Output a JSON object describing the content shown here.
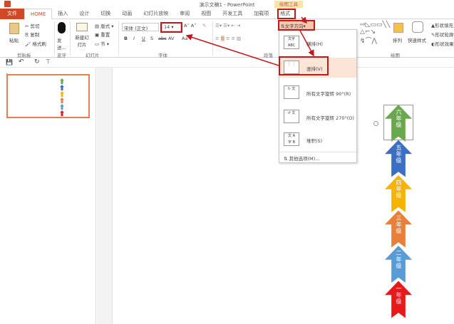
{
  "window": {
    "title": "演示文稿1 - PowerPoint",
    "context_tab_group": "绘图工具"
  },
  "tabs": [
    "文件",
    "HOME",
    "插入",
    "设计",
    "切换",
    "动画",
    "幻灯片放映",
    "审阅",
    "视图",
    "开发工具",
    "加载项",
    "格式"
  ],
  "ribbon": {
    "clipboard": {
      "paste": "粘贴",
      "cut": "剪切",
      "copy": "复制",
      "format_painter": "格式刷",
      "label": "剪贴板"
    },
    "bluetooth": {
      "send": "发送...",
      "label": "蓝牙"
    },
    "slides": {
      "new_slide": "新建幻灯片",
      "layout": "版式",
      "reset": "重置",
      "section": "节",
      "label": "幻灯片"
    },
    "font": {
      "font_name": "宋体 (正文)",
      "font_size": "14",
      "bold": "B",
      "italic": "I",
      "underline": "U",
      "shadow": "S",
      "strike": "abc",
      "spacing": "AV",
      "case": "Aa",
      "label": "字体"
    },
    "paragraph": {
      "text_direction": "文字方向",
      "label": "段落"
    },
    "drawing": {
      "arrange": "排列",
      "quick_styles": "快速样式",
      "shape_fill": "形状填充",
      "shape_outline": "形状轮廓",
      "shape_effects": "形状效果",
      "label": "绘图"
    }
  },
  "text_direction_menu": [
    {
      "icon": "文字 ABC",
      "label": "横排(H)"
    },
    {
      "icon": "竖排",
      "label": "竖排(V)",
      "highlighted": true
    },
    {
      "icon": "旋转90",
      "label": "所有文字旋转 90°(R)"
    },
    {
      "icon": "旋转270",
      "label": "所有文字旋转 270°(O)"
    },
    {
      "icon": "堆积",
      "label": "堆积(S)"
    }
  ],
  "more_options": "其他选项(M)...",
  "slide_panel": {
    "slide_number": "1"
  },
  "arrows": [
    {
      "label": "六年级",
      "color": "#6aa84f"
    },
    {
      "label": "五年级",
      "color": "#3c6fc4"
    },
    {
      "label": "四年级",
      "color": "#f4b400"
    },
    {
      "label": "三年级",
      "color": "#e8803a"
    },
    {
      "label": "二年级",
      "color": "#5b9bd5"
    },
    {
      "label": "一年级",
      "color": "#e8191b"
    }
  ],
  "annotation_color": "#c0191b"
}
